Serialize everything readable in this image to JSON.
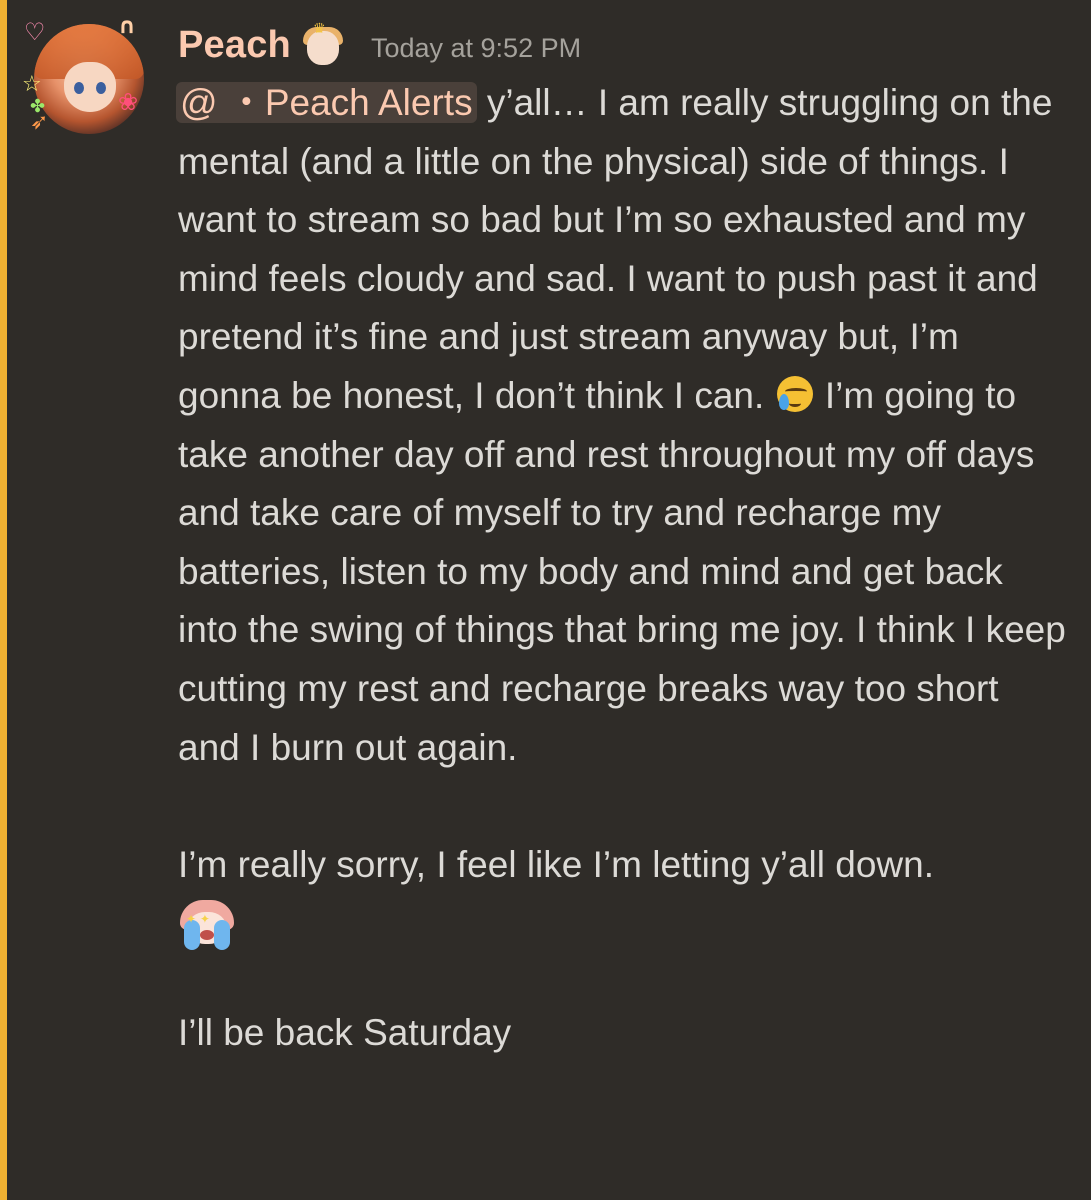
{
  "message": {
    "author": {
      "username": "Peach",
      "avatar_icon": "anime-avatar-icon",
      "role_icon": "crowned-avatar-role-icon"
    },
    "timestamp": "Today at 9:52 PM",
    "mention": "@ ・Peach Alerts",
    "paragraph1_text": " y’all… I am really struggling on the mental (and a little on the physical) side of things. I want to stream so bad but I’m so exhausted and my mind feels cloudy and sad. I want to push past it and pretend it’s fine and just stream anyway but, I’m gonna be honest, I don’t think I can. ",
    "paragraph1_emoji": "face-holding-back-tears-emoji",
    "paragraph1_text_after": " I’m going to take another day off and rest throughout my off days and take care of myself to try and recharge my batteries, listen to my body and mind and get back into the swing of things that bring me joy. I think I keep cutting my rest and recharge breaks way too short and I burn out again.",
    "paragraph2_text": "I’m really sorry, I feel like I’m letting y’all down.",
    "paragraph2_emote": "crying-anime-emote",
    "paragraph3_text": "I’ll be back Saturday"
  },
  "colors": {
    "background": "#2f2c28",
    "mention_bar": "#f0b132",
    "username": "#fbc9b0",
    "text": "#dcdad6",
    "timestamp": "#a5a29c"
  }
}
